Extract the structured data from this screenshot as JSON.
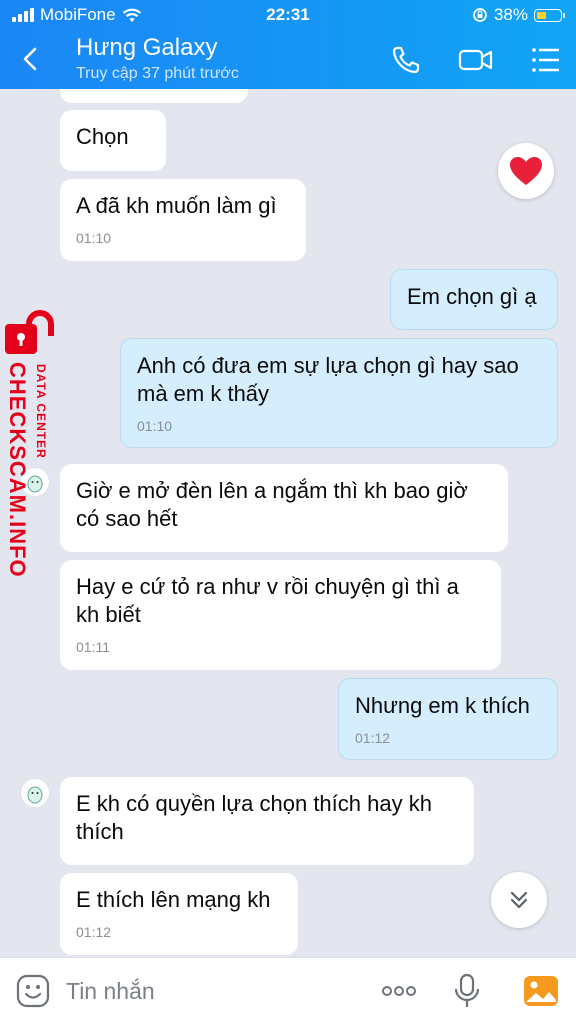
{
  "status_bar": {
    "carrier": "MobiFone",
    "time": "22:31",
    "battery": "38%"
  },
  "header": {
    "contact_name": "Hưng Galaxy",
    "contact_status": "Truy cập 37 phút trước"
  },
  "messages": [
    {
      "side": "in",
      "text": "Chọn",
      "time": ""
    },
    {
      "side": "in",
      "text": "A đã kh muốn làm gì",
      "time": "01:10"
    },
    {
      "side": "out",
      "text": "Em chọn gì ạ",
      "time": ""
    },
    {
      "side": "out",
      "text": "Anh có đưa em sự lựa chọn gì hay sao mà em k thấy",
      "time": "01:10"
    },
    {
      "side": "in",
      "text": "Giờ e mở đèn lên a ngắm thì kh bao giờ có sao hết",
      "time": ""
    },
    {
      "side": "in",
      "text": "Hay e cứ tỏ ra như v rồi chuyện gì thì a kh biết",
      "time": "01:11"
    },
    {
      "side": "out",
      "text": "Nhưng em k thích",
      "time": "01:12"
    },
    {
      "side": "in",
      "text": "E kh có quyền lựa chọn thích hay kh thích",
      "time": ""
    },
    {
      "side": "in",
      "text": "E thích lên mạng kh",
      "time": "01:12"
    }
  ],
  "reaction": {
    "icon": "heart-icon",
    "color": "#e8203a"
  },
  "watermark": {
    "main": "CHECKSCAM.INFO",
    "sub": "DATA CENTER"
  },
  "input": {
    "placeholder": "Tin nhắn"
  },
  "colors": {
    "header_start": "#1b86f5",
    "header_end": "#11a5f5",
    "outgoing_bubble": "#d4eefd",
    "incoming_bubble": "#ffffff",
    "background": "#e3e6ee"
  }
}
